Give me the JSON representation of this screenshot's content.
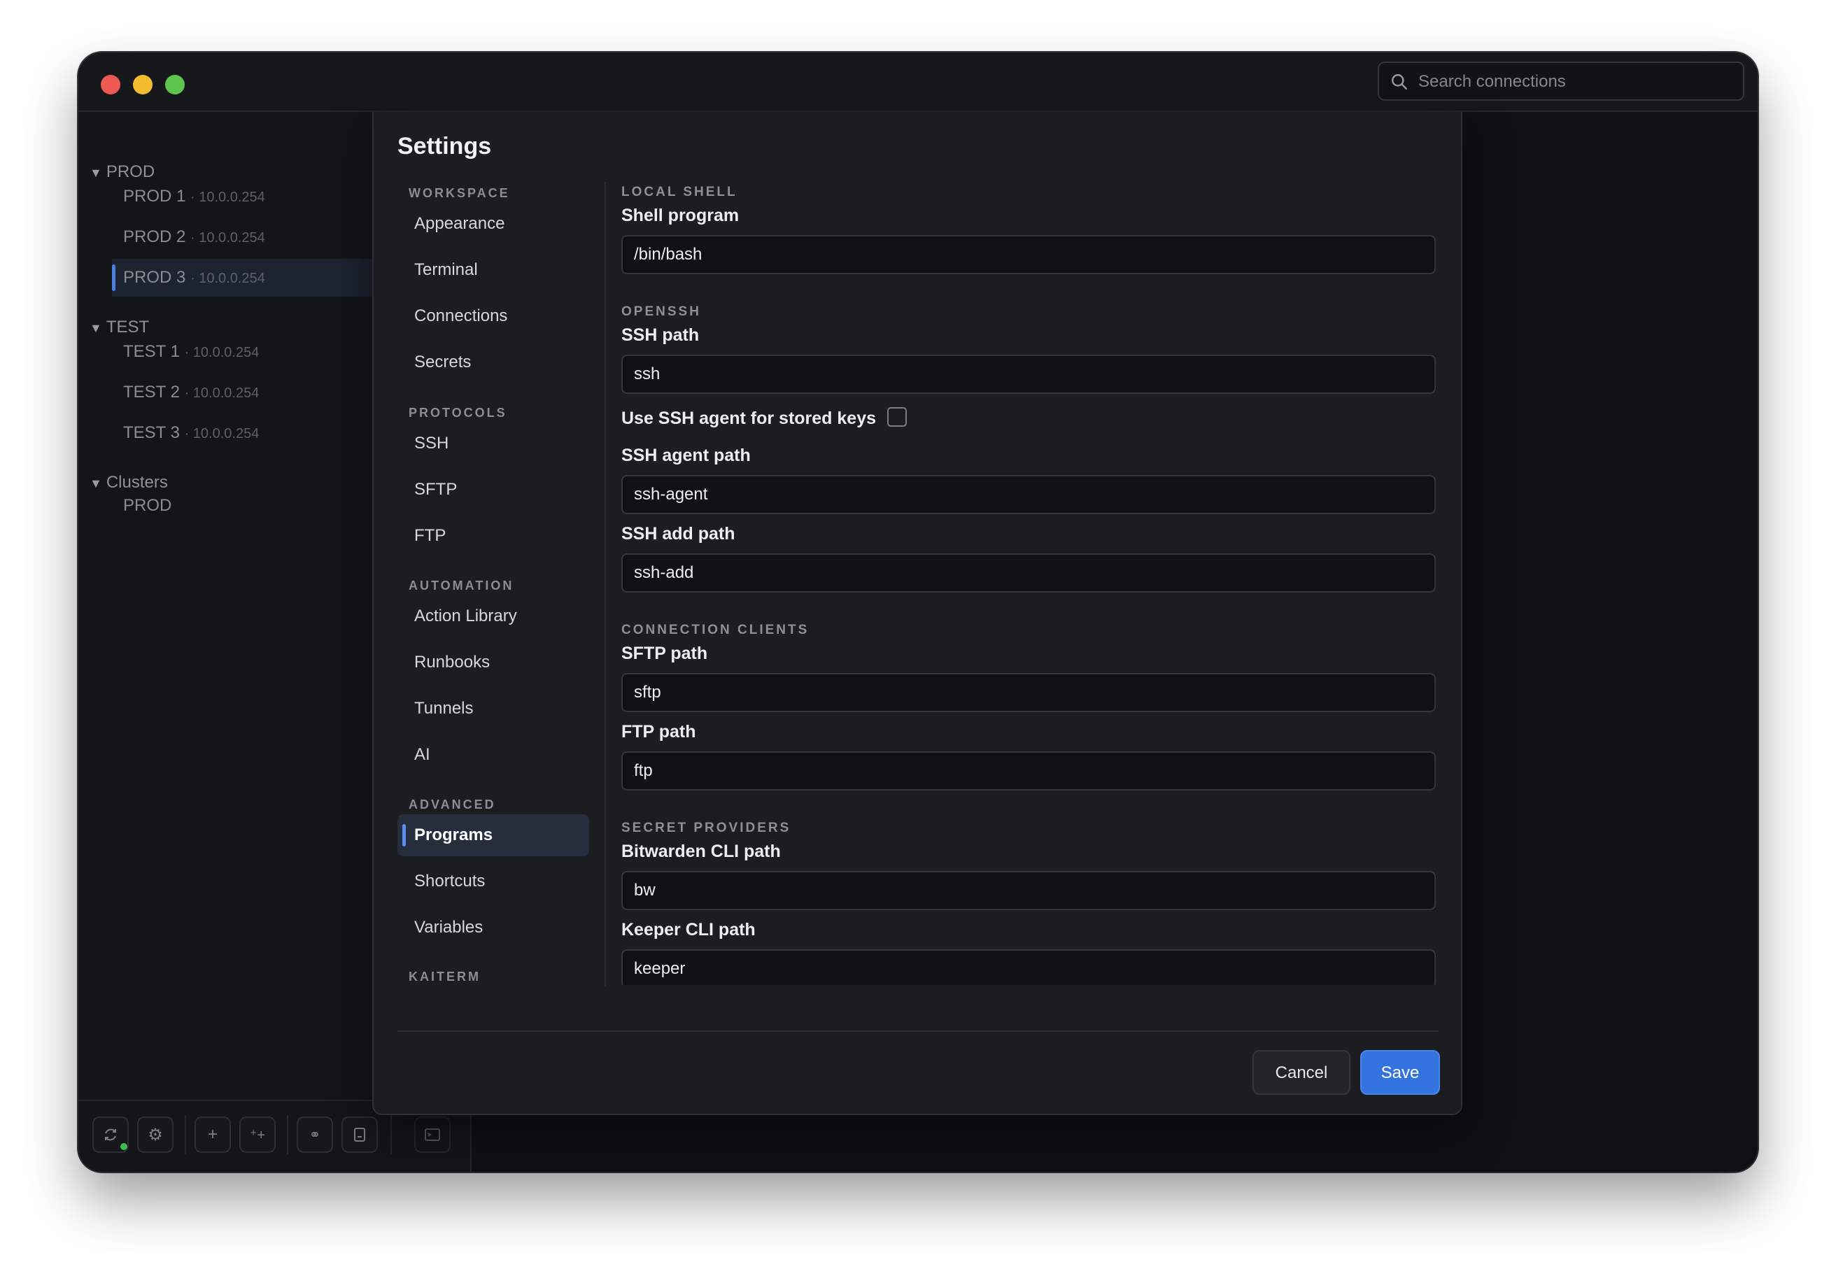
{
  "search": {
    "placeholder": "Search connections"
  },
  "sidebar": {
    "groups": [
      {
        "label": "PROD",
        "items": [
          {
            "name": "PROD 1",
            "ip": "· 10.0.0.254"
          },
          {
            "name": "PROD 2",
            "ip": "· 10.0.0.254"
          },
          {
            "name": "PROD 3",
            "ip": "· 10.0.0.254"
          }
        ]
      },
      {
        "label": "TEST",
        "items": [
          {
            "name": "TEST 1",
            "ip": "· 10.0.0.254"
          },
          {
            "name": "TEST 2",
            "ip": "· 10.0.0.254"
          },
          {
            "name": "TEST 3",
            "ip": "· 10.0.0.254"
          }
        ]
      },
      {
        "label": "Clusters",
        "items": [
          {
            "name": "PROD",
            "ip": ""
          }
        ]
      }
    ],
    "active_item": "PROD 3"
  },
  "settings": {
    "title": "Settings",
    "nav": {
      "workspace": {
        "label": "WORKSPACE",
        "items": [
          "Appearance",
          "Terminal",
          "Connections",
          "Secrets"
        ]
      },
      "protocols": {
        "label": "PROTOCOLS",
        "items": [
          "SSH",
          "SFTP",
          "FTP"
        ]
      },
      "automation": {
        "label": "AUTOMATION",
        "items": [
          "Action Library",
          "Runbooks",
          "Tunnels",
          "AI"
        ]
      },
      "advanced": {
        "label": "ADVANCED",
        "items": [
          "Programs",
          "Shortcuts",
          "Variables"
        ]
      },
      "kaiterm": {
        "label": "KAITERM"
      }
    },
    "active_nav": "Programs",
    "content": {
      "local_shell": {
        "heading": "LOCAL SHELL",
        "shell_label": "Shell program",
        "shell_value": "/bin/bash"
      },
      "openssh": {
        "heading": "OPENSSH",
        "ssh_path_label": "SSH path",
        "ssh_path_value": "ssh",
        "agent_toggle_label": "Use SSH agent for stored keys",
        "agent_toggle_checked": false,
        "agent_path_label": "SSH agent path",
        "agent_path_value": "ssh-agent",
        "add_path_label": "SSH add path",
        "add_path_value": "ssh-add"
      },
      "connection_clients": {
        "heading": "CONNECTION CLIENTS",
        "sftp_label": "SFTP path",
        "sftp_value": "sftp",
        "ftp_label": "FTP path",
        "ftp_value": "ftp"
      },
      "secret_providers": {
        "heading": "SECRET PROVIDERS",
        "bitwarden_label": "Bitwarden CLI path",
        "bitwarden_value": "bw",
        "keeper_label": "Keeper CLI path",
        "keeper_value": "keeper"
      }
    },
    "buttons": {
      "cancel": "Cancel",
      "save": "Save"
    }
  },
  "toolbar": {
    "icons": [
      "sync-icon",
      "gear-icon",
      "plus-icon",
      "add-sparkle-icon",
      "link-icon",
      "bookmark-icon",
      "terminal-icon"
    ]
  },
  "colors": {
    "accent": "#3474e0",
    "window_bg": "#0f1012",
    "dialog_bg": "#1c1d21"
  }
}
